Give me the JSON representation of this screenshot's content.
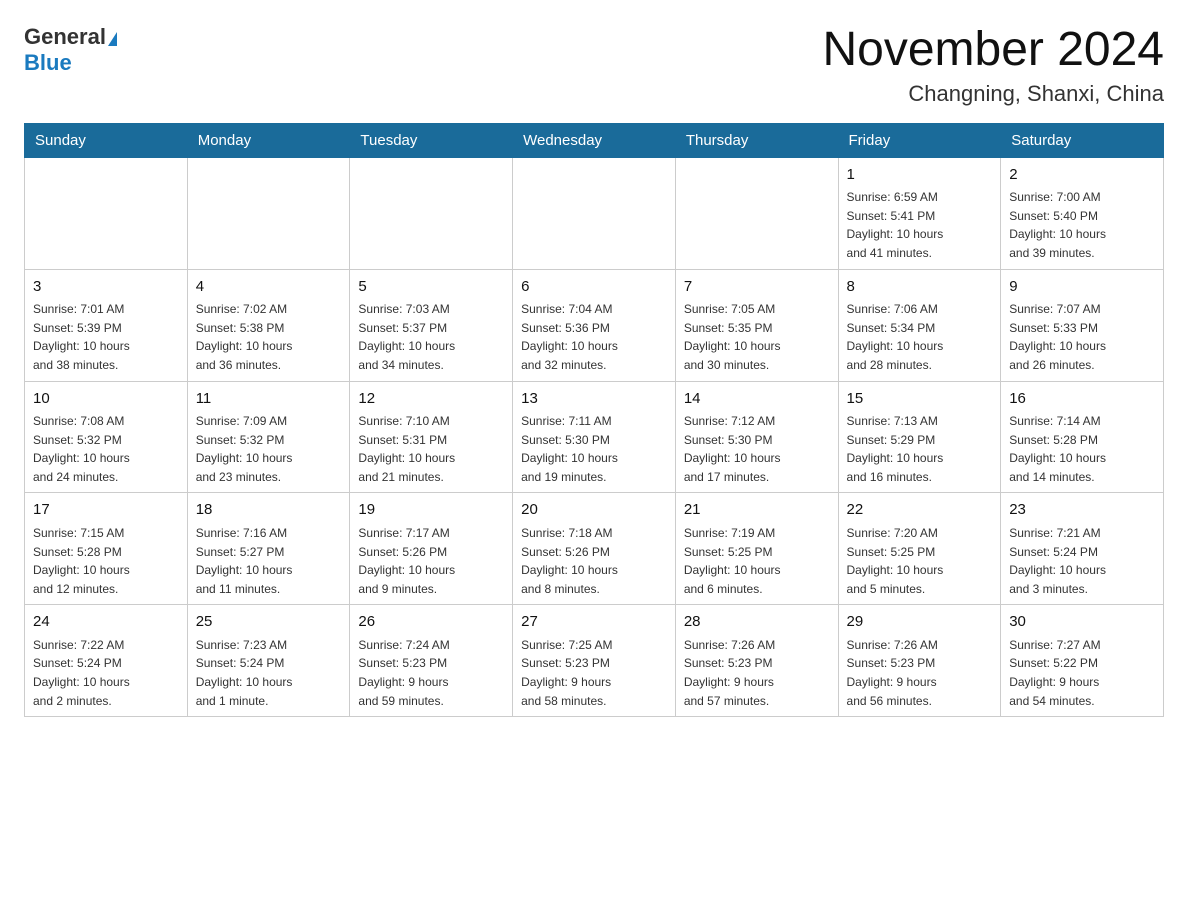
{
  "header": {
    "logo_general": "General",
    "logo_blue": "Blue",
    "month_year": "November 2024",
    "location": "Changning, Shanxi, China"
  },
  "days_of_week": [
    "Sunday",
    "Monday",
    "Tuesday",
    "Wednesday",
    "Thursday",
    "Friday",
    "Saturday"
  ],
  "weeks": [
    [
      {
        "day": "",
        "info": ""
      },
      {
        "day": "",
        "info": ""
      },
      {
        "day": "",
        "info": ""
      },
      {
        "day": "",
        "info": ""
      },
      {
        "day": "",
        "info": ""
      },
      {
        "day": "1",
        "info": "Sunrise: 6:59 AM\nSunset: 5:41 PM\nDaylight: 10 hours\nand 41 minutes."
      },
      {
        "day": "2",
        "info": "Sunrise: 7:00 AM\nSunset: 5:40 PM\nDaylight: 10 hours\nand 39 minutes."
      }
    ],
    [
      {
        "day": "3",
        "info": "Sunrise: 7:01 AM\nSunset: 5:39 PM\nDaylight: 10 hours\nand 38 minutes."
      },
      {
        "day": "4",
        "info": "Sunrise: 7:02 AM\nSunset: 5:38 PM\nDaylight: 10 hours\nand 36 minutes."
      },
      {
        "day": "5",
        "info": "Sunrise: 7:03 AM\nSunset: 5:37 PM\nDaylight: 10 hours\nand 34 minutes."
      },
      {
        "day": "6",
        "info": "Sunrise: 7:04 AM\nSunset: 5:36 PM\nDaylight: 10 hours\nand 32 minutes."
      },
      {
        "day": "7",
        "info": "Sunrise: 7:05 AM\nSunset: 5:35 PM\nDaylight: 10 hours\nand 30 minutes."
      },
      {
        "day": "8",
        "info": "Sunrise: 7:06 AM\nSunset: 5:34 PM\nDaylight: 10 hours\nand 28 minutes."
      },
      {
        "day": "9",
        "info": "Sunrise: 7:07 AM\nSunset: 5:33 PM\nDaylight: 10 hours\nand 26 minutes."
      }
    ],
    [
      {
        "day": "10",
        "info": "Sunrise: 7:08 AM\nSunset: 5:32 PM\nDaylight: 10 hours\nand 24 minutes."
      },
      {
        "day": "11",
        "info": "Sunrise: 7:09 AM\nSunset: 5:32 PM\nDaylight: 10 hours\nand 23 minutes."
      },
      {
        "day": "12",
        "info": "Sunrise: 7:10 AM\nSunset: 5:31 PM\nDaylight: 10 hours\nand 21 minutes."
      },
      {
        "day": "13",
        "info": "Sunrise: 7:11 AM\nSunset: 5:30 PM\nDaylight: 10 hours\nand 19 minutes."
      },
      {
        "day": "14",
        "info": "Sunrise: 7:12 AM\nSunset: 5:30 PM\nDaylight: 10 hours\nand 17 minutes."
      },
      {
        "day": "15",
        "info": "Sunrise: 7:13 AM\nSunset: 5:29 PM\nDaylight: 10 hours\nand 16 minutes."
      },
      {
        "day": "16",
        "info": "Sunrise: 7:14 AM\nSunset: 5:28 PM\nDaylight: 10 hours\nand 14 minutes."
      }
    ],
    [
      {
        "day": "17",
        "info": "Sunrise: 7:15 AM\nSunset: 5:28 PM\nDaylight: 10 hours\nand 12 minutes."
      },
      {
        "day": "18",
        "info": "Sunrise: 7:16 AM\nSunset: 5:27 PM\nDaylight: 10 hours\nand 11 minutes."
      },
      {
        "day": "19",
        "info": "Sunrise: 7:17 AM\nSunset: 5:26 PM\nDaylight: 10 hours\nand 9 minutes."
      },
      {
        "day": "20",
        "info": "Sunrise: 7:18 AM\nSunset: 5:26 PM\nDaylight: 10 hours\nand 8 minutes."
      },
      {
        "day": "21",
        "info": "Sunrise: 7:19 AM\nSunset: 5:25 PM\nDaylight: 10 hours\nand 6 minutes."
      },
      {
        "day": "22",
        "info": "Sunrise: 7:20 AM\nSunset: 5:25 PM\nDaylight: 10 hours\nand 5 minutes."
      },
      {
        "day": "23",
        "info": "Sunrise: 7:21 AM\nSunset: 5:24 PM\nDaylight: 10 hours\nand 3 minutes."
      }
    ],
    [
      {
        "day": "24",
        "info": "Sunrise: 7:22 AM\nSunset: 5:24 PM\nDaylight: 10 hours\nand 2 minutes."
      },
      {
        "day": "25",
        "info": "Sunrise: 7:23 AM\nSunset: 5:24 PM\nDaylight: 10 hours\nand 1 minute."
      },
      {
        "day": "26",
        "info": "Sunrise: 7:24 AM\nSunset: 5:23 PM\nDaylight: 9 hours\nand 59 minutes."
      },
      {
        "day": "27",
        "info": "Sunrise: 7:25 AM\nSunset: 5:23 PM\nDaylight: 9 hours\nand 58 minutes."
      },
      {
        "day": "28",
        "info": "Sunrise: 7:26 AM\nSunset: 5:23 PM\nDaylight: 9 hours\nand 57 minutes."
      },
      {
        "day": "29",
        "info": "Sunrise: 7:26 AM\nSunset: 5:23 PM\nDaylight: 9 hours\nand 56 minutes."
      },
      {
        "day": "30",
        "info": "Sunrise: 7:27 AM\nSunset: 5:22 PM\nDaylight: 9 hours\nand 54 minutes."
      }
    ]
  ]
}
